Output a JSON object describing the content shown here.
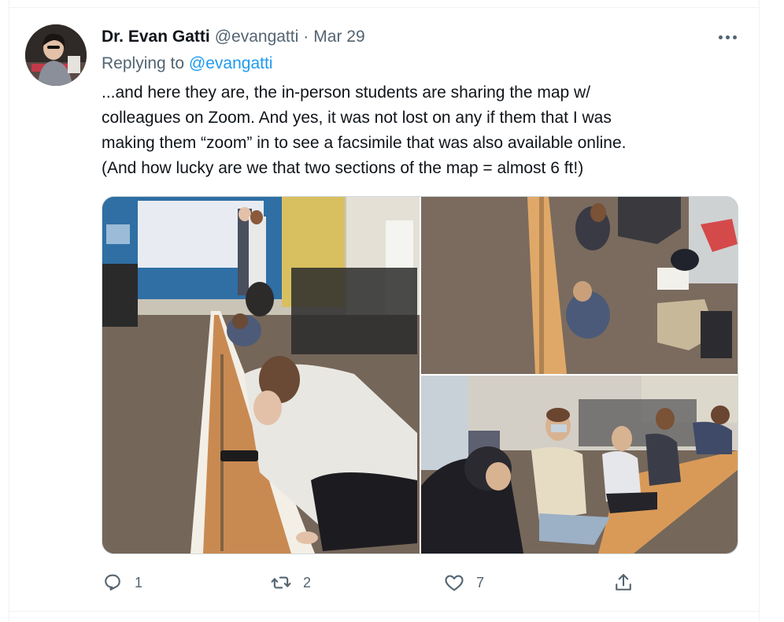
{
  "tweet": {
    "display_name": "Dr. Evan Gatti",
    "handle": "@evangatti",
    "separator": "·",
    "date": "Mar 29",
    "replying_to_label": "Replying to",
    "replying_to_handle": "@evangatti",
    "text_lines": [
      "...and here they are, the in-person students are sharing the map w/",
      "colleagues on Zoom. And yes, it was not lost on any if them that I was",
      "making them “zoom” in to see a facsimile that was also available online.",
      "(And how lucky are we that two sections of the map = almost 6 ft!)"
    ]
  },
  "media": [
    {
      "kind": "photo",
      "icon": "photo-students-kneeling-by-long-map-scroll"
    },
    {
      "kind": "photo",
      "icon": "photo-students-sitting-on-floor-overhead"
    },
    {
      "kind": "photo",
      "icon": "photo-students-seated-along-map-scroll"
    }
  ],
  "actions": {
    "reply_count": "1",
    "retweet_count": "2",
    "like_count": "7",
    "share_count": ""
  },
  "icons": {
    "more": "more-options-icon",
    "reply": "reply-icon",
    "retweet": "retweet-icon",
    "like": "heart-icon",
    "share": "share-icon"
  },
  "colors": {
    "accent": "#1d9bf0",
    "text_primary": "#0f1419",
    "text_secondary": "#536471",
    "border": "#cfd9de"
  }
}
